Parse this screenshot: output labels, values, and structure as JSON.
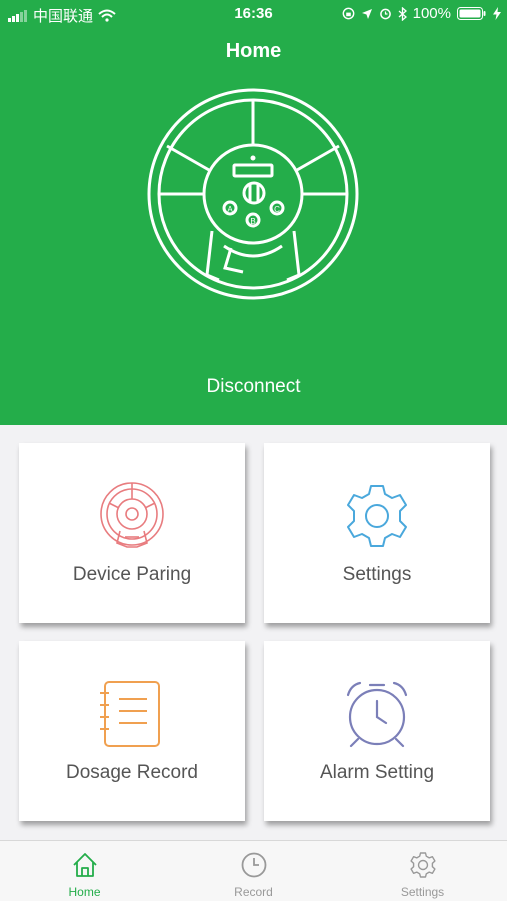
{
  "status_bar": {
    "carrier": "中国联通",
    "time": "16:36",
    "battery": "100%"
  },
  "header": {
    "title": "Home"
  },
  "device": {
    "connection_status": "Disconnect",
    "button_labels": [
      "A",
      "B",
      "C"
    ]
  },
  "menu": [
    {
      "label": "Device Paring",
      "icon": "device-pairing-icon",
      "color": "#e87c7f"
    },
    {
      "label": "Settings",
      "icon": "gear-icon",
      "color": "#4aa8dc"
    },
    {
      "label": "Dosage Record",
      "icon": "notebook-icon",
      "color": "#f0a050"
    },
    {
      "label": "Alarm Setting",
      "icon": "alarm-clock-icon",
      "color": "#7b7fb8"
    }
  ],
  "tab_bar": {
    "active": "Home",
    "items": [
      {
        "label": "Home",
        "icon": "home-icon"
      },
      {
        "label": "Record",
        "icon": "clock-icon"
      },
      {
        "label": "Settings",
        "icon": "gear-icon"
      }
    ]
  },
  "colors": {
    "primary": "#24ad4a",
    "background": "#f2f2f4"
  }
}
